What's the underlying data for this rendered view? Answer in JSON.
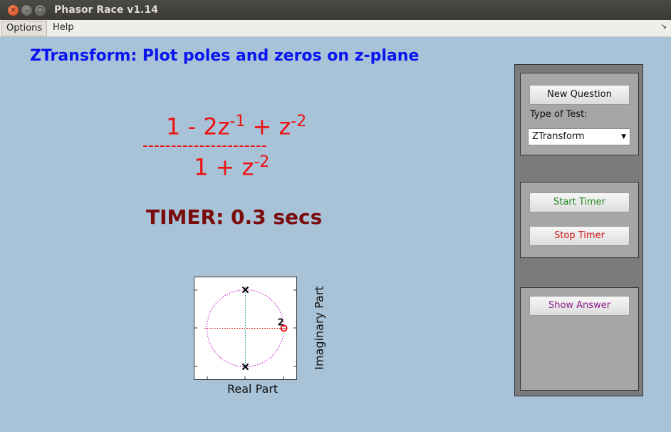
{
  "window": {
    "title": "Phasor Race v1.14",
    "close_glyph": "✕",
    "min_glyph": "–",
    "max_glyph": "▢"
  },
  "menubar": {
    "options": "Options",
    "help": "Help",
    "corner_glyph": "↘"
  },
  "main": {
    "heading": "ZTransform: Plot poles and zeros on z-plane",
    "numerator": {
      "a": "1 - 2z",
      "exp1": "-1",
      "b": " + z",
      "exp2": "-2"
    },
    "fraction_line": "----------------------",
    "denominator": {
      "a": "1 + z",
      "exp1": "-2"
    },
    "timer": "TIMER: 0.3 secs"
  },
  "plot": {
    "xlabel": "Real Part",
    "ylabel": "Imaginary Part",
    "zero_multiplicity": "2",
    "poles": [
      {
        "re": 0,
        "im": 1
      },
      {
        "re": 0,
        "im": -1
      }
    ],
    "zeros": [
      {
        "re": 1,
        "im": 0
      }
    ],
    "colors": {
      "circle": "#cc00cc",
      "axis": "#cc0000",
      "pole": "#000000",
      "zero": "#ee1111"
    }
  },
  "sidebar": {
    "new_question": "New Question",
    "type_label": "Type of Test:",
    "type_value": "ZTransform",
    "start_timer": "Start Timer",
    "stop_timer": "Stop Timer",
    "show_answer": "Show Answer",
    "dropdown_glyph": "▼"
  }
}
